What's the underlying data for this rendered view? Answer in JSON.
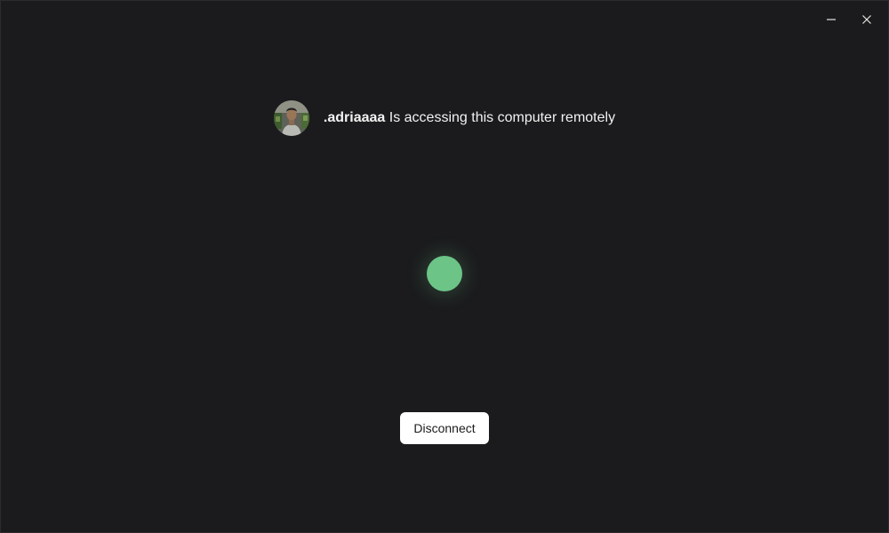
{
  "window_controls": {
    "minimize_icon": "minimize-icon",
    "close_icon": "close-icon"
  },
  "session": {
    "username": ".adriaaaa",
    "message": " Is accessing this computer remotely",
    "avatar_icon": "user-avatar"
  },
  "status": {
    "indicator_color": "#6cc487"
  },
  "actions": {
    "disconnect_label": "Disconnect"
  },
  "colors": {
    "background": "#1b1b1d",
    "text": "#f2f2f2",
    "button_bg": "#ffffff"
  }
}
